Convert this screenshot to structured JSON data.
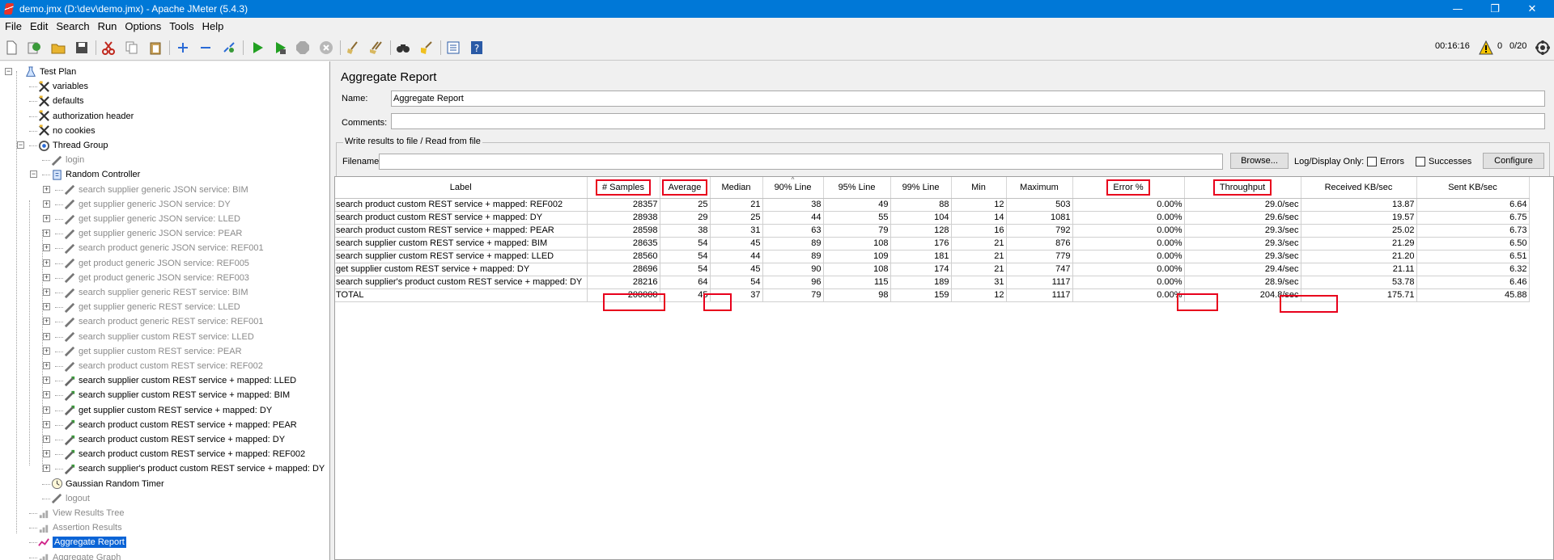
{
  "window": {
    "title": "demo.jmx (D:\\dev\\demo.jmx) - Apache JMeter (5.4.3)",
    "minimize": "—",
    "maximize": "❐",
    "close": "✕"
  },
  "menu": [
    "File",
    "Edit",
    "Search",
    "Run",
    "Options",
    "Tools",
    "Help"
  ],
  "toolbar": {
    "elapsed": "00:16:16",
    "warnings": "0",
    "threads": "0/20",
    "icons": [
      "new-icon",
      "templates-icon",
      "open-icon",
      "save-icon",
      "cut-icon",
      "copy-icon",
      "paste-icon",
      "expand-icon",
      "collapse-icon",
      "toggle-icon",
      "start-icon",
      "start-no-pauses-icon",
      "stop-icon",
      "shutdown-icon",
      "clear-icon",
      "clear-all-icon",
      "search-icon",
      "reset-search-icon",
      "function-helper-icon",
      "help-icon"
    ]
  },
  "tree": {
    "items": [
      {
        "label": "Test Plan",
        "icon": "test-plan-icon",
        "disabled": false
      },
      {
        "label": "variables",
        "icon": "config-icon",
        "disabled": false
      },
      {
        "label": "defaults",
        "icon": "config-icon",
        "disabled": false
      },
      {
        "label": "authorization header",
        "icon": "config-icon",
        "disabled": false
      },
      {
        "label": "no cookies",
        "icon": "config-icon",
        "disabled": false
      },
      {
        "label": "Thread Group",
        "icon": "thread-group-icon",
        "disabled": false
      },
      {
        "label": "login",
        "icon": "sampler-icon",
        "disabled": true
      },
      {
        "label": "Random Controller",
        "icon": "controller-icon",
        "disabled": false
      },
      {
        "label": "search supplier generic JSON service: BIM",
        "icon": "sampler-icon",
        "disabled": true
      },
      {
        "label": "get supplier generic JSON service: DY",
        "icon": "sampler-icon",
        "disabled": true
      },
      {
        "label": "get supplier generic JSON service: LLED",
        "icon": "sampler-icon",
        "disabled": true
      },
      {
        "label": "get supplier generic JSON service: PEAR",
        "icon": "sampler-icon",
        "disabled": true
      },
      {
        "label": "search product generic JSON service: REF001",
        "icon": "sampler-icon",
        "disabled": true
      },
      {
        "label": "get product generic JSON service: REF005",
        "icon": "sampler-icon",
        "disabled": true
      },
      {
        "label": "get product generic JSON service: REF003",
        "icon": "sampler-icon",
        "disabled": true
      },
      {
        "label": "search supplier generic REST service: BIM",
        "icon": "sampler-icon",
        "disabled": true
      },
      {
        "label": "get supplier generic REST service: LLED",
        "icon": "sampler-icon",
        "disabled": true
      },
      {
        "label": "search product generic REST service: REF001",
        "icon": "sampler-icon",
        "disabled": true
      },
      {
        "label": "search supplier custom REST service: LLED",
        "icon": "sampler-icon",
        "disabled": true
      },
      {
        "label": "get supplier custom REST service: PEAR",
        "icon": "sampler-icon",
        "disabled": true
      },
      {
        "label": "search product custom REST service: REF002",
        "icon": "sampler-icon",
        "disabled": true
      },
      {
        "label": "search supplier custom REST service + mapped: LLED",
        "icon": "sampler-icon",
        "disabled": false
      },
      {
        "label": "search supplier custom REST service + mapped: BIM",
        "icon": "sampler-icon",
        "disabled": false
      },
      {
        "label": "get supplier custom REST service + mapped: DY",
        "icon": "sampler-icon",
        "disabled": false
      },
      {
        "label": "search product custom REST service + mapped: PEAR",
        "icon": "sampler-icon",
        "disabled": false
      },
      {
        "label": "search product custom REST service + mapped: DY",
        "icon": "sampler-icon",
        "disabled": false
      },
      {
        "label": "search product custom REST service + mapped: REF002",
        "icon": "sampler-icon",
        "disabled": false
      },
      {
        "label": "search supplier's product custom REST service + mapped: DY",
        "icon": "sampler-icon",
        "disabled": false
      },
      {
        "label": "Gaussian Random Timer",
        "icon": "timer-icon",
        "disabled": false
      },
      {
        "label": "logout",
        "icon": "sampler-icon",
        "disabled": true
      },
      {
        "label": "View Results Tree",
        "icon": "listener-icon",
        "disabled": true
      },
      {
        "label": "Assertion Results",
        "icon": "listener-icon",
        "disabled": true
      },
      {
        "label": "Aggregate Report",
        "icon": "listener-icon",
        "disabled": false,
        "selected": true
      },
      {
        "label": "Aggregate Graph",
        "icon": "listener-icon",
        "disabled": true
      }
    ]
  },
  "panel": {
    "title": "Aggregate Report",
    "name_label": "Name:",
    "name_value": "Aggregate Report",
    "comments_label": "Comments:",
    "comments_value": "",
    "file_group_title": "Write results to file / Read from file",
    "filename_label": "Filename",
    "filename_value": "",
    "browse": "Browse...",
    "log_display": "Log/Display Only:",
    "errors": "Errors",
    "successes": "Successes",
    "configure": "Configure"
  },
  "table": {
    "columns": [
      "Label",
      "# Samples",
      "Average",
      "Median",
      "90% Line",
      "95% Line",
      "99% Line",
      "Min",
      "Maximum",
      "Error %",
      "Throughput",
      "Received KB/sec",
      "Sent KB/sec"
    ],
    "highlighted_columns": [
      "# Samples",
      "Average",
      "Error %",
      "Throughput"
    ],
    "sort_indicator": "^",
    "rows": [
      [
        "search product custom REST service + mapped: REF002",
        "28357",
        "25",
        "21",
        "38",
        "49",
        "88",
        "12",
        "503",
        "0.00%",
        "29.0/sec",
        "13.87",
        "6.64"
      ],
      [
        "search product custom REST service + mapped: DY",
        "28938",
        "29",
        "25",
        "44",
        "55",
        "104",
        "14",
        "1081",
        "0.00%",
        "29.6/sec",
        "19.57",
        "6.75"
      ],
      [
        "search product custom REST service + mapped: PEAR",
        "28598",
        "38",
        "31",
        "63",
        "79",
        "128",
        "16",
        "792",
        "0.00%",
        "29.3/sec",
        "25.02",
        "6.73"
      ],
      [
        "search supplier custom REST service + mapped: BIM",
        "28635",
        "54",
        "45",
        "89",
        "108",
        "176",
        "21",
        "876",
        "0.00%",
        "29.3/sec",
        "21.29",
        "6.50"
      ],
      [
        "search supplier custom REST service + mapped: LLED",
        "28560",
        "54",
        "44",
        "89",
        "109",
        "181",
        "21",
        "779",
        "0.00%",
        "29.3/sec",
        "21.20",
        "6.51"
      ],
      [
        "get supplier custom REST service + mapped: DY",
        "28696",
        "54",
        "45",
        "90",
        "108",
        "174",
        "21",
        "747",
        "0.00%",
        "29.4/sec",
        "21.11",
        "6.32"
      ],
      [
        "search supplier's product custom REST service + mapped: DY",
        "28216",
        "64",
        "54",
        "96",
        "115",
        "189",
        "31",
        "1117",
        "0.00%",
        "28.9/sec",
        "53.78",
        "6.46"
      ],
      [
        "TOTAL",
        "200000",
        "45",
        "37",
        "79",
        "98",
        "159",
        "12",
        "1117",
        "0.00%",
        "204.8/sec",
        "175.71",
        "45.88"
      ]
    ]
  },
  "colors": {
    "titlebar": "#0078d7",
    "selection": "#0a64d6",
    "highlight_box": "#e8001c"
  }
}
